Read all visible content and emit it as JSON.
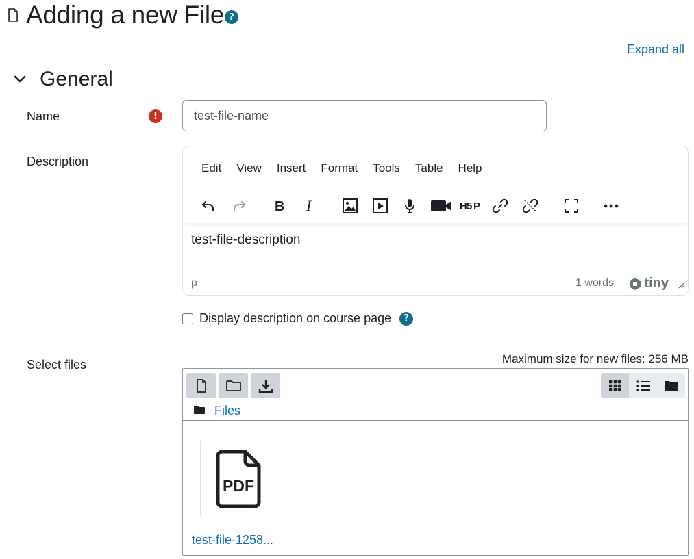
{
  "page": {
    "title": "Adding a new File",
    "help_glyph": "?",
    "expand_all": "Expand all"
  },
  "section": {
    "title": "General"
  },
  "form": {
    "name_label": "Name",
    "name_required_glyph": "!",
    "name_value": "test-file-name",
    "description_label": "Description",
    "display_desc_label": "Display description on course page",
    "select_files_label": "Select files",
    "max_size_text": "Maximum size for new files: 256 MB"
  },
  "editor": {
    "menus": [
      "Edit",
      "View",
      "Insert",
      "Format",
      "Tools",
      "Table",
      "Help"
    ],
    "toolbar_icons": [
      "undo-icon",
      "redo-icon",
      "bold-icon",
      "italic-icon",
      "image-icon",
      "media-icon",
      "microphone-icon",
      "video-camera-icon",
      "h5p-icon",
      "link-icon",
      "unlink-icon",
      "fullscreen-icon",
      "more-icon"
    ],
    "content": "test-file-description",
    "status_path": "p",
    "word_count": "1 words",
    "brand": "tiny"
  },
  "filepicker": {
    "buttons": [
      "add-file-icon",
      "create-folder-icon",
      "download-icon"
    ],
    "views": [
      "grid-view-icon",
      "list-view-icon",
      "tree-view-icon"
    ],
    "path_label": "Files",
    "files": [
      {
        "name": "test-file-1258...",
        "icon": "pdf-file-icon",
        "icon_text": "PDF"
      }
    ]
  },
  "colors": {
    "link": "#0f6cbf",
    "help": "#0f6f8a",
    "required": "#ca3120",
    "button_bg": "#ced4da"
  }
}
